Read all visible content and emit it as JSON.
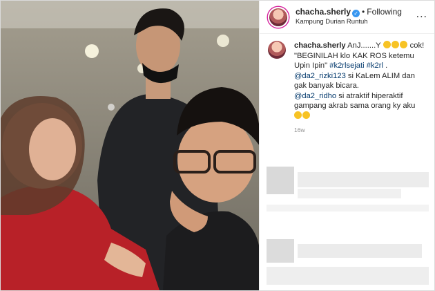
{
  "header": {
    "username": "chacha.sherly",
    "follow_status": "Following",
    "location": "Kampung Durian Runtuh",
    "more_label": "..."
  },
  "caption": {
    "username": "chacha.sherly",
    "line1": "AnJ.......Y",
    "line2": "cok! \"BEGINILAH klo KAK ROS ketemu Upin Ipin\"",
    "hashtag1": "#k2rlsejati",
    "hashtag2": "#k2rl",
    "mention1": "@da2_rizki123",
    "mention1_text": "si KaLem ALIM dan gak banyak bicara.",
    "mention2": "@da2_ridho",
    "mention2_text": "si atraktif hiperaktif gampang akrab sama orang ky aku"
  },
  "timestamp": "16w",
  "colors": {
    "link": "#00376b",
    "verified": "#3897f0",
    "text": "#262626",
    "muted": "#8e8e8e"
  }
}
